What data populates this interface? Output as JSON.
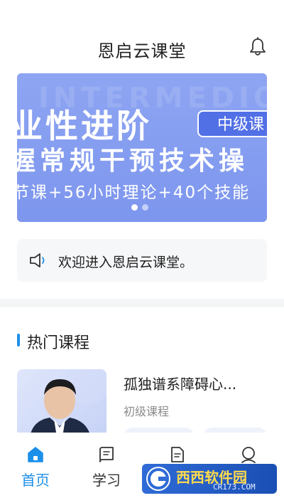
{
  "header": {
    "title": "恩启云课堂",
    "bell_icon": "bell-icon"
  },
  "banner": {
    "ghost_text": "INTERMEDIO",
    "line1": "业性进阶",
    "level_tag": "中级课",
    "line2": "握常规干预技术操",
    "line3": "节课+56小时理论+40个技能",
    "slide_count": 2,
    "active_slide": 1
  },
  "notice": {
    "icon": "speaker-icon",
    "text": "欢迎进入恩启云课堂。"
  },
  "hot_courses": {
    "section_title": "热门课程",
    "items": [
      {
        "title": "孤独谱系障碍心...",
        "level": "初级课程"
      }
    ]
  },
  "tabbar": {
    "tabs": [
      {
        "label": "首页",
        "icon": "home-icon",
        "active": true
      },
      {
        "label": "学习",
        "icon": "study-icon",
        "active": false
      },
      {
        "label": "",
        "icon": "document-icon",
        "active": false
      },
      {
        "label": "",
        "icon": "profile-icon",
        "active": false
      }
    ]
  },
  "watermark": {
    "title": "西西软件园",
    "url": "CR173.COM"
  },
  "colors": {
    "accent": "#1c8fe9",
    "banner_bg": "#8ea5f2",
    "banner_tag": "#5270e6",
    "notice_bg": "#f6f7f9"
  }
}
